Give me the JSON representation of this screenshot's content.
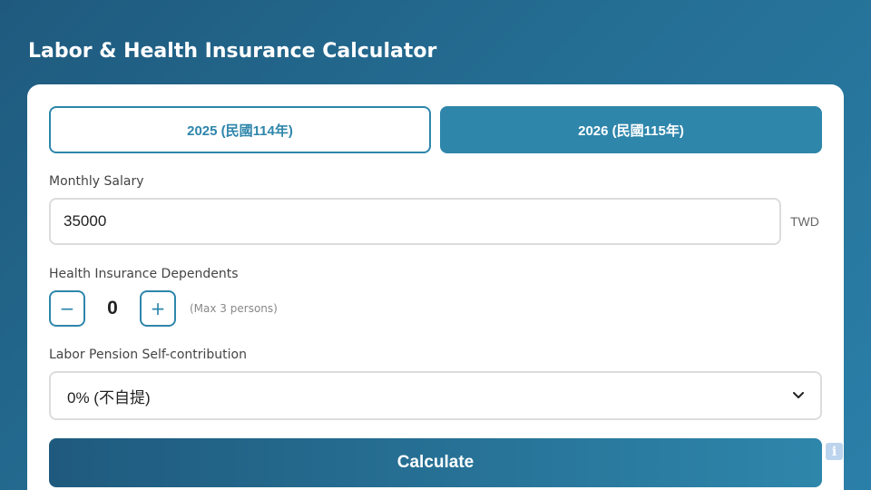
{
  "app": {
    "title": "Labor & Health Insurance Calculator"
  },
  "year_tabs": [
    {
      "label": "2025 (民國114年)",
      "active": false
    },
    {
      "label": "2026 (民國115年)",
      "active": true
    }
  ],
  "salary": {
    "label": "Monthly Salary",
    "value": "35000",
    "unit": "TWD"
  },
  "dependents": {
    "label": "Health Insurance Dependents",
    "decrement_label": "−",
    "increment_label": "+",
    "value": "0",
    "hint": "(Max 3 persons)"
  },
  "pension": {
    "label": "Labor Pension Self-contribution",
    "selected": "0% (不自提)"
  },
  "calculate": {
    "label": "Calculate"
  },
  "info": {
    "label": "i"
  },
  "colors": {
    "primary": "#2e86ab",
    "primary_dark": "#1f5a7e",
    "card_bg": "#ffffff",
    "border": "#dcdcdc"
  }
}
